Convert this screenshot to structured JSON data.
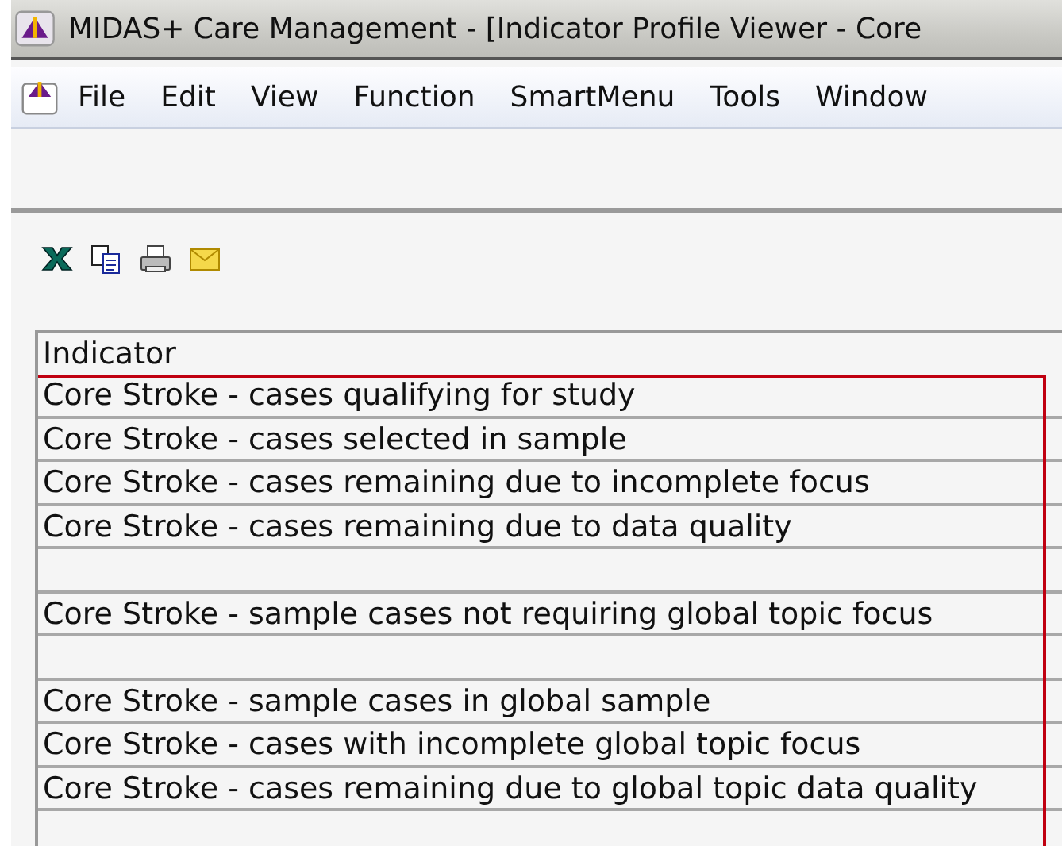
{
  "window": {
    "title": "MIDAS+ Care Management - [Indicator Profile Viewer - Core"
  },
  "menu": [
    "File",
    "Edit",
    "View",
    "Function",
    "SmartMenu",
    "Tools",
    "Window"
  ],
  "toolbar": [
    {
      "kind": "excel"
    },
    {
      "kind": "copy"
    },
    {
      "kind": "print"
    },
    {
      "kind": "email"
    }
  ],
  "table": {
    "columns": [
      "Indicator"
    ],
    "highlighted": true,
    "rows": [
      {
        "kind": "indicator",
        "text": "Core Stroke - cases qualifying for study"
      },
      {
        "kind": "indicator",
        "text": "Core Stroke - cases selected in sample"
      },
      {
        "kind": "indicator",
        "text": "Core Stroke - cases remaining due to incomplete focus"
      },
      {
        "kind": "indicator",
        "text": "Core Stroke - cases remaining due to data quality"
      },
      {
        "kind": "blank"
      },
      {
        "kind": "indicator",
        "text": "Core Stroke - sample cases not requiring global topic focus"
      },
      {
        "kind": "blank"
      },
      {
        "kind": "indicator",
        "text": "Core Stroke - sample cases in global sample"
      },
      {
        "kind": "indicator",
        "text": "Core Stroke - cases with incomplete global topic focus"
      },
      {
        "kind": "indicator",
        "text": "Core Stroke - cases remaining due to global topic data quality"
      },
      {
        "kind": "blank"
      }
    ]
  }
}
